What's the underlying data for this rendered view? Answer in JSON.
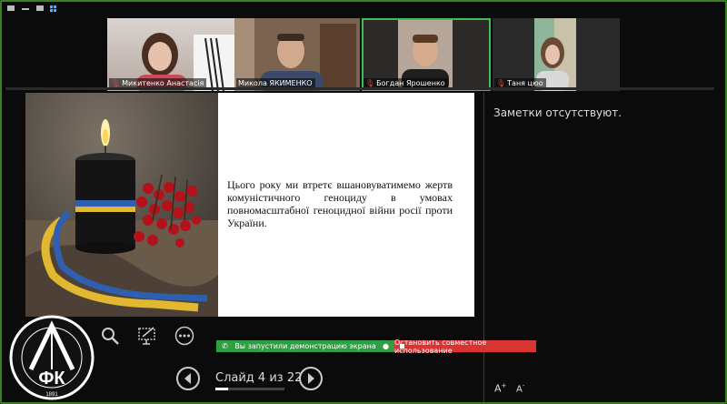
{
  "participants": [
    {
      "name": "Микитенко Анастасія",
      "muted": true
    },
    {
      "name": "Микола ЯКИМЕНКО",
      "muted": false
    },
    {
      "name": "Богдан Ярошенко",
      "muted": true
    },
    {
      "name": "Таня цюо",
      "muted": true
    }
  ],
  "slide": {
    "text": "Цього року ми втретє вшановуватимемо жертв комуністичного геноциду в умовах повномасштабної геноцидної війни росії проти України."
  },
  "notes": {
    "text": "Заметки отсутствуют."
  },
  "presenter": {
    "current_slide": 4,
    "total_slides": 22,
    "counter_label": "Слайд 4 из 22",
    "progress_fraction": 0.18
  },
  "share": {
    "status_label": "Вы запустили демонстрацию экрана",
    "stop_label": "Остановить совместное использование"
  },
  "font_controls": {
    "increase": "A",
    "decrease": "A"
  },
  "logo": {
    "text": "ФК",
    "ring_text": "ПЛЕВСЬКИЙ ЛІСОТЕХНІЧНИЙ ФАХОВИЙ КОЛЕДЖ",
    "year": "1891"
  },
  "colors": {
    "frame": "#3c7f1f",
    "share_ok": "#2ea043",
    "share_stop": "#d93434",
    "active_speaker": "#3fbf4f"
  }
}
